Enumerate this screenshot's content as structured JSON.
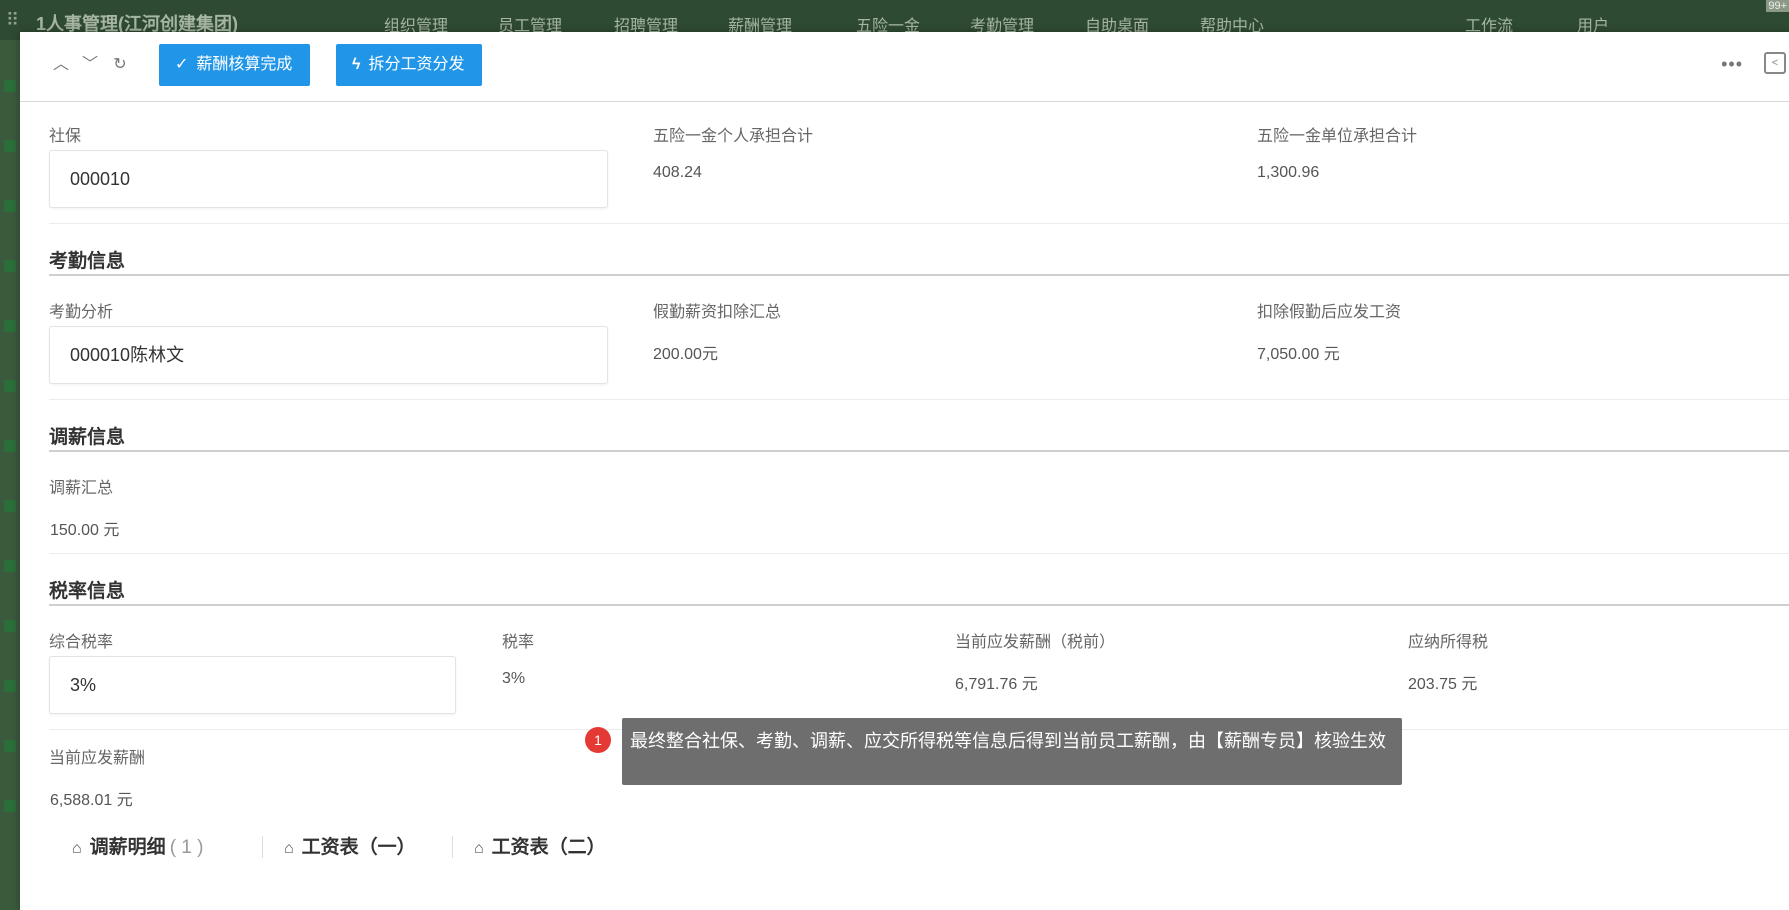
{
  "app": {
    "brand": "1人事管理(江河创建集团)",
    "nav": [
      "组织管理",
      "员工管理",
      "招聘管理",
      "薪酬管理",
      "五险一金",
      "考勤管理",
      "自助桌面",
      "帮助中心"
    ],
    "right_nav": [
      "工作流",
      "用户"
    ],
    "badge": "99+"
  },
  "toolbar": {
    "confirm_label": "薪酬核算完成",
    "split_label": "拆分工资分发",
    "more": "•••"
  },
  "social": {
    "label": "社保",
    "value": "000010",
    "personal_label": "五险一金个人承担合计",
    "personal_value": "408.24",
    "company_label": "五险一金单位承担合计",
    "company_value": "1,300.96"
  },
  "attendance": {
    "title": "考勤信息",
    "analysis_label": "考勤分析",
    "analysis_value": "000010陈林文",
    "deduct_label": "假勤薪资扣除汇总",
    "deduct_value": "200.00元",
    "after_label": "扣除假勤后应发工资",
    "after_value": "7,050.00 元"
  },
  "adjust": {
    "title": "调薪信息",
    "sum_label": "调薪汇总",
    "sum_value": "150.00 元"
  },
  "tax": {
    "title": "税率信息",
    "combined_label": "综合税率",
    "combined_value": "3%",
    "rate_label": "税率",
    "rate_value": "3%",
    "pretax_label": "当前应发薪酬（税前）",
    "pretax_value": "6,791.76 元",
    "taxdue_label": "应纳所得税",
    "taxdue_value": "203.75 元",
    "current_label": "当前应发薪酬",
    "current_value": "6,588.01 元"
  },
  "tooltip": {
    "step": "1",
    "text": "最终整合社保、考勤、调薪、应交所得税等信息后得到当前员工薪酬，由【薪酬专员】核验生效"
  },
  "tabs": [
    {
      "label": "调薪明细",
      "count": "( 1 )"
    },
    {
      "label": "工资表（一）"
    },
    {
      "label": "工资表（二）"
    }
  ]
}
